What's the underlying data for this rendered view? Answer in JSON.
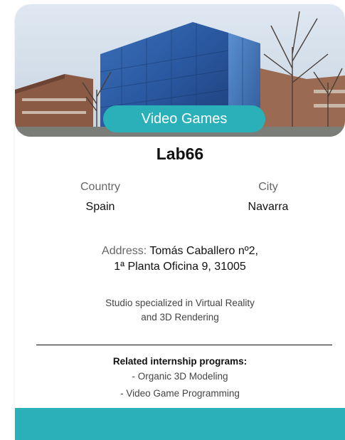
{
  "category_badge": "Video Games",
  "studio": {
    "name": "Lab66",
    "country_label": "Country",
    "country": "Spain",
    "city_label": "City",
    "city": "Navarra",
    "address_label": "Address:",
    "address_line1": "Tomás Caballero nº2,",
    "address_line2": "1ª Planta Oficina 9, 31005",
    "description_line1": "Studio specialized in Virtual Reality",
    "description_line2": "and 3D Rendering"
  },
  "related": {
    "title": "Related internship programs:",
    "programs": [
      "- Organic 3D Modeling",
      "- Video Game Programming"
    ]
  },
  "colors": {
    "accent": "#2ab0b8"
  }
}
